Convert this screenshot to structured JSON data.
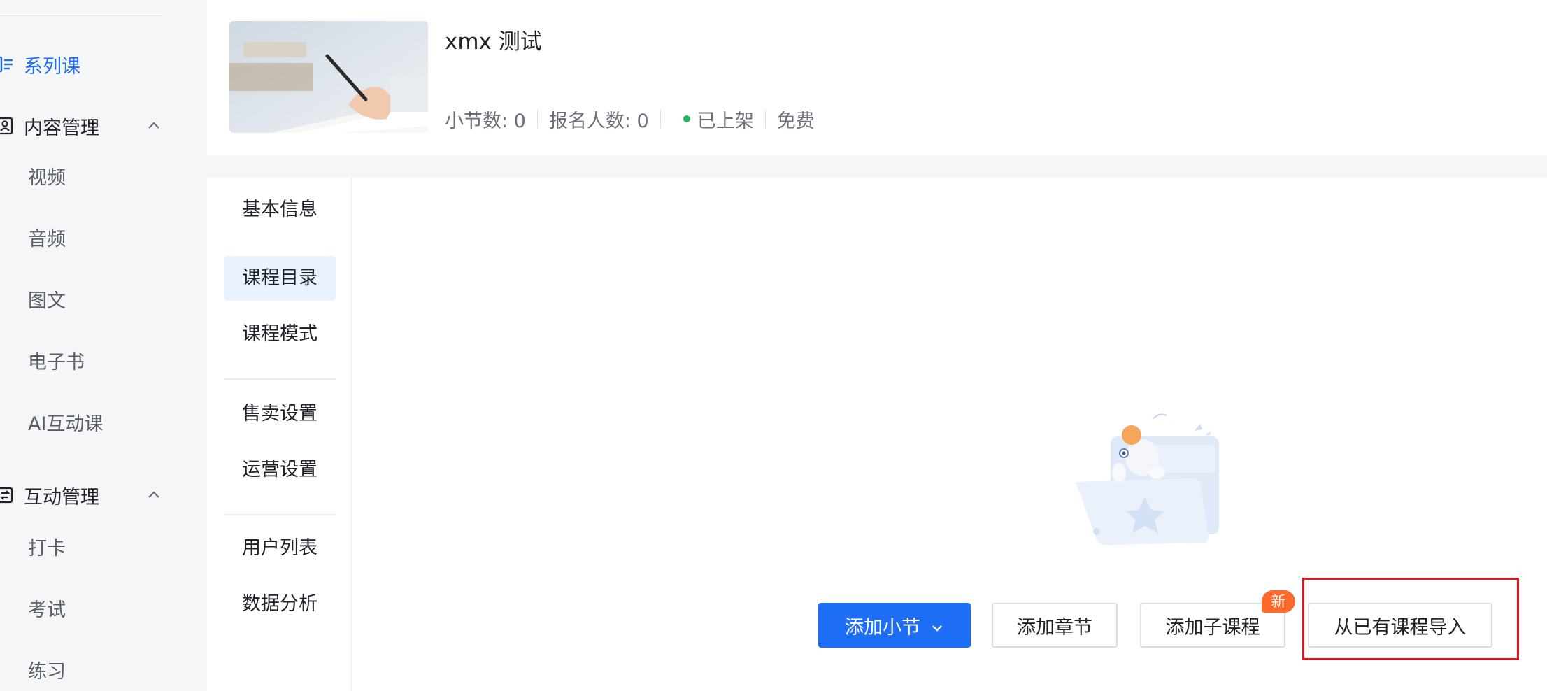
{
  "sidebar": {
    "active_item": {
      "label": "系列课",
      "icon": "list-icon"
    },
    "groups": [
      {
        "label": "内容管理",
        "icon": "contact-card-icon",
        "items": [
          "视频",
          "音频",
          "图文",
          "电子书",
          "AI互动课"
        ]
      },
      {
        "label": "互动管理",
        "icon": "exchange-icon",
        "items": [
          "打卡",
          "考试",
          "练习"
        ]
      }
    ]
  },
  "course": {
    "title": "xmx 测试",
    "lessons_label": "小节数: 0",
    "enrolled_label": "报名人数: 0",
    "status_label": "已上架",
    "price_label": "免费",
    "status_color": "#22b45b"
  },
  "tabs": [
    "基本信息",
    "课程目录",
    "课程模式",
    "售卖设置",
    "运营设置",
    "用户列表",
    "数据分析"
  ],
  "active_tab": "课程目录",
  "actions": {
    "add_lesson": "添加小节",
    "add_chapter": "添加章节",
    "add_subcourse": "添加子课程",
    "new_badge": "新",
    "import_course": "从已有课程导入"
  },
  "colors": {
    "accent": "#1e6df5",
    "badge": "#ff6a2c",
    "highlight": "#e0141e"
  }
}
